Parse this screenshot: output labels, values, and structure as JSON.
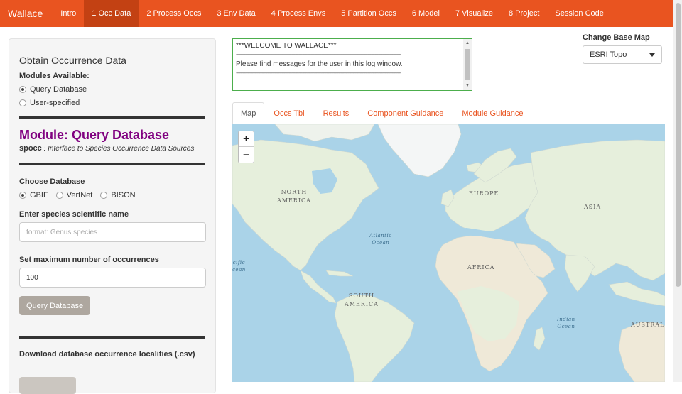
{
  "navbar": {
    "brand": "Wallace",
    "items": [
      {
        "label": "Intro"
      },
      {
        "label": "1 Occ Data",
        "active": true
      },
      {
        "label": "2 Process Occs"
      },
      {
        "label": "3 Env Data"
      },
      {
        "label": "4 Process Envs"
      },
      {
        "label": "5 Partition Occs"
      },
      {
        "label": "6 Model"
      },
      {
        "label": "7 Visualize"
      },
      {
        "label": "8 Project"
      },
      {
        "label": "Session Code"
      }
    ]
  },
  "sidebar": {
    "title": "Obtain Occurrence Data",
    "modules_label": "Modules Available:",
    "modules": [
      {
        "label": "Query Database",
        "selected": true
      },
      {
        "label": "User-specified",
        "selected": false
      }
    ],
    "module_title": "Module: Query Database",
    "package_name": "spocc",
    "package_desc": ": Interface to Species Occurrence Data Sources",
    "choose_db_label": "Choose Database",
    "databases": [
      {
        "label": "GBIF",
        "selected": true
      },
      {
        "label": "VertNet",
        "selected": false
      },
      {
        "label": "BISON",
        "selected": false
      }
    ],
    "species_label": "Enter species scientific name",
    "species_placeholder": "format: Genus species",
    "max_label": "Set maximum number of occurrences",
    "max_value": "100",
    "query_button": "Query Database",
    "download_label": "Download database occurrence localities (.csv)"
  },
  "log": {
    "line1": "***WELCOME TO WALLACE***",
    "dashes": "-------------------------------------------------------------------------------------------------------------------------------------------",
    "line2": "Please find messages for the user in this log window."
  },
  "basemap": {
    "label": "Change Base Map",
    "selected": "ESRI Topo"
  },
  "tabs": [
    {
      "label": "Map",
      "active": true
    },
    {
      "label": "Occs Tbl"
    },
    {
      "label": "Results"
    },
    {
      "label": "Component Guidance"
    },
    {
      "label": "Module Guidance"
    }
  ],
  "map": {
    "zoom_in": "+",
    "zoom_out": "−",
    "labels": {
      "north_america_1": "NORTH",
      "north_america_2": "AMERICA",
      "europe": "EUROPE",
      "asia": "ASIA",
      "africa": "AFRICA",
      "south_america_1": "SOUTH",
      "south_america_2": "AMERICA",
      "australia": "AUSTRAL",
      "atlantic_1": "Atlantic",
      "atlantic_2": "Ocean",
      "pacific_1": "cific",
      "pacific_2": "cean",
      "indian_1": "Indian",
      "indian_2": "Ocean"
    },
    "colors": {
      "ocean": "#aad3e8",
      "land": "#e6efdc",
      "ice": "#f4f6f6",
      "desert": "#efe9d8"
    }
  }
}
